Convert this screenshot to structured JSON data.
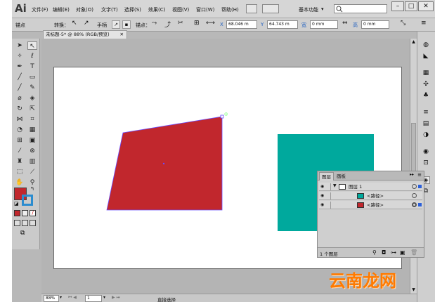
{
  "app": {
    "logo": "Ai"
  },
  "menu": [
    "文件(F)",
    "编辑(E)",
    "对象(O)",
    "文字(T)",
    "选择(S)",
    "效果(C)",
    "视图(V)",
    "窗口(W)",
    "帮助(H)"
  ],
  "workspace": {
    "label": "基本功能",
    "arrow": "▾"
  },
  "window_controls": {
    "minimize": "–",
    "maximize": "□",
    "close": "✕"
  },
  "control_bar": {
    "selection_label": "锚点",
    "convert_label": "转换：",
    "handle_label": "手柄",
    "anchor_label": "锚点：",
    "x_label": "X",
    "x_value": "68.046 m",
    "y_label": "Y",
    "y_value": "64.743 m",
    "w_label": "宽",
    "w_value": "0 mm",
    "h_label": "高",
    "h_value": "0 mm"
  },
  "document_tab": {
    "title": "未标题-5* @ 88% (RGB/预览)",
    "close": "✕"
  },
  "layers_panel": {
    "tabs": [
      "图层",
      "画板"
    ],
    "rows": [
      {
        "name": "图层 1",
        "swatch": "#333333",
        "kind": "layer"
      },
      {
        "name": "<路径>",
        "swatch": "#00a99d",
        "kind": "path"
      },
      {
        "name": "<路径>",
        "swatch": "#c1272d",
        "kind": "path"
      }
    ],
    "footer_label": "1 个图层"
  },
  "status_bar": {
    "zoom": "88%",
    "page": "1",
    "tool_label": "直接选择"
  },
  "watermark": "云南龙网",
  "colors": {
    "red_shape": "#c1272d",
    "teal_shape": "#00a99d",
    "selection_outline": "#6a4cff",
    "anchor_green": "#4fff4f",
    "menubar": "#d6d6d6",
    "canvas_bg": "#b4b4b4"
  }
}
